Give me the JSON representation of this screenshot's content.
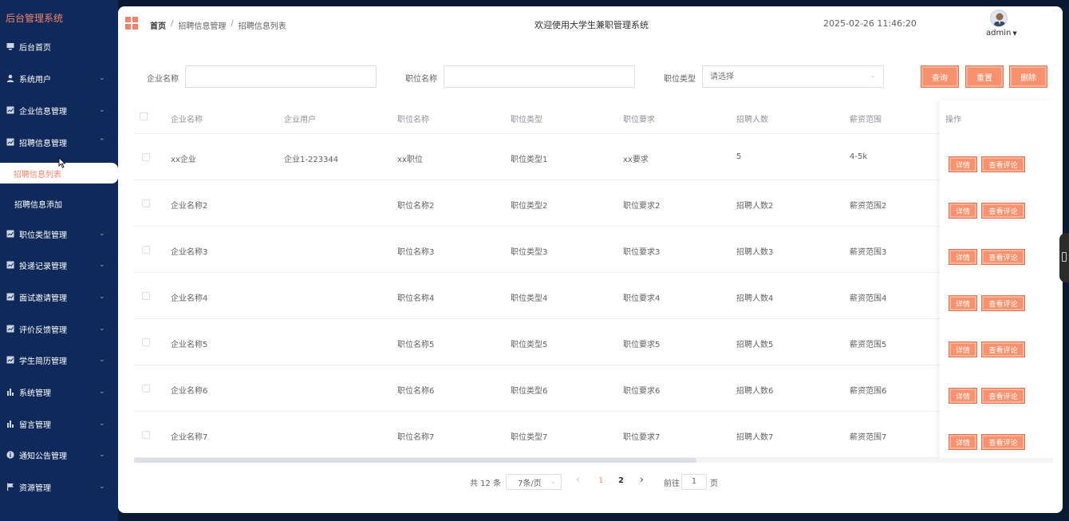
{
  "sidebar": {
    "brand": "后台管理系统",
    "items": [
      {
        "label": "后台首页",
        "icon": "monitor-icon",
        "expandable": false
      },
      {
        "label": "系统用户",
        "icon": "user-icon",
        "expandable": true
      },
      {
        "label": "企业信息管理",
        "icon": "grid-icon",
        "expandable": true
      },
      {
        "label": "招聘信息管理",
        "icon": "grid-icon",
        "expandable": true,
        "open": true
      },
      {
        "label": "职位类型管理",
        "icon": "grid-icon",
        "expandable": true
      },
      {
        "label": "投递记录管理",
        "icon": "grid-icon",
        "expandable": true
      },
      {
        "label": "面试邀请管理",
        "icon": "grid-icon",
        "expandable": true
      },
      {
        "label": "评价反馈管理",
        "icon": "grid-icon",
        "expandable": true
      },
      {
        "label": "学生简历管理",
        "icon": "grid-icon",
        "expandable": true
      },
      {
        "label": "系统管理",
        "icon": "bar-chart-icon",
        "expandable": true
      },
      {
        "label": "留言管理",
        "icon": "bar-chart-icon",
        "expandable": true
      },
      {
        "label": "通知公告管理",
        "icon": "info-icon",
        "expandable": true
      },
      {
        "label": "资源管理",
        "icon": "flag-icon",
        "expandable": true
      }
    ],
    "sub_items": [
      {
        "label": "招聘信息列表",
        "active": true
      },
      {
        "label": "招聘信息添加",
        "active": false
      }
    ]
  },
  "header": {
    "breadcrumb": [
      "首页",
      "招聘信息管理",
      "招聘信息列表"
    ],
    "welcome": "欢迎使用大学生兼职管理系统",
    "datetime": "2025-02-26 11:46:20",
    "user": "admin"
  },
  "search": {
    "company_label": "企业名称",
    "company_value": "",
    "position_label": "职位名称",
    "position_value": "",
    "type_label": "职位类型",
    "type_placeholder": "请选择",
    "query_button": "查询",
    "reset_button": "重置",
    "delete_button": "删除"
  },
  "table": {
    "headers": [
      "企业名称",
      "企业用户",
      "职位名称",
      "职位类型",
      "职位要求",
      "招聘人数",
      "薪资范围",
      "操作"
    ],
    "rows": [
      [
        "xx企业",
        "企业1-223344",
        "xx职位",
        "职位类型1",
        "xx要求",
        "5",
        "4-5k"
      ],
      [
        "企业名称2",
        "",
        "职位名称2",
        "职位类型2",
        "职位要求2",
        "招聘人数2",
        "薪资范围2"
      ],
      [
        "企业名称3",
        "",
        "职位名称3",
        "职位类型3",
        "职位要求3",
        "招聘人数3",
        "薪资范围3"
      ],
      [
        "企业名称4",
        "",
        "职位名称4",
        "职位类型4",
        "职位要求4",
        "招聘人数4",
        "薪资范围4"
      ],
      [
        "企业名称5",
        "",
        "职位名称5",
        "职位类型5",
        "职位要求5",
        "招聘人数5",
        "薪资范围5"
      ],
      [
        "企业名称6",
        "",
        "职位名称6",
        "职位类型6",
        "职位要求6",
        "招聘人数6",
        "薪资范围6"
      ],
      [
        "企业名称7",
        "",
        "职位名称7",
        "职位类型7",
        "职位要求7",
        "招聘人数7",
        "薪资范围7"
      ]
    ],
    "detail_button": "详情",
    "review_button": "查看评论"
  },
  "pagination": {
    "total": "共 12 条",
    "page_size": "7条/页",
    "prev": "‹",
    "next": "›",
    "pages": [
      "1",
      "2"
    ],
    "current_page": "1",
    "goto_label": "前往",
    "goto_value": "1",
    "page_unit": "页"
  },
  "colors": {
    "accent": "#f7916e",
    "sidebar_bg": "#0f2a5a",
    "brand": "#f0846a"
  }
}
